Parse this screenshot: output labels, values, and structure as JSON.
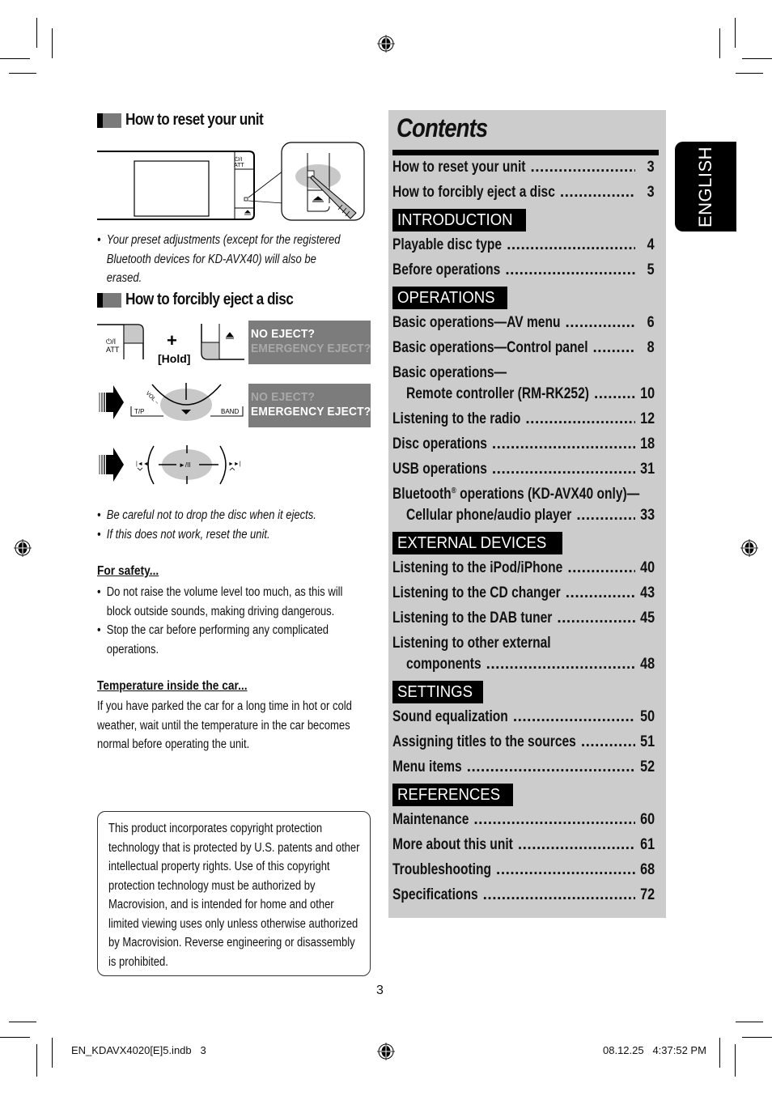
{
  "reset": {
    "title": "How to reset your unit",
    "bullets": [
      "Your preset adjustments (except for the registered Bluetooth devices for KD-AVX40) will also be erased."
    ],
    "illustration_labels": {
      "power": "⏻/I",
      "att": "ATT"
    }
  },
  "eject": {
    "title": "How to forcibly eject a disc",
    "plus": "+",
    "hold": "[Hold]",
    "power_label": "⏻/I",
    "att_label": "ATT",
    "lcd1": {
      "line1": "NO EJECT?",
      "line2": "EMERGENCY EJECT?"
    },
    "lcd2": {
      "line1": "NO EJECT?",
      "line2": "EMERGENCY EJECT?"
    },
    "dial_labels": {
      "vol": "VOL –",
      "tp": "T/P",
      "band": "BAND",
      "play_pause": "►/II"
    },
    "bullets": [
      "Be careful not to drop the disc when it ejects.",
      "If this does not work, reset the unit."
    ]
  },
  "safety": {
    "title": "For safety...",
    "bullets": [
      "Do not raise the volume level too much, as this will block outside sounds, making driving dangerous.",
      "Stop the car before performing any complicated operations."
    ]
  },
  "temperature": {
    "title": "Temperature inside the car...",
    "text": "If you have parked the car for a long time in hot or cold weather, wait until the temperature in the car becomes normal before operating the unit."
  },
  "notice": {
    "text": "This product incorporates copyright protection technology that is protected by U.S. patents and other intellectual property rights. Use of this copyright protection technology must be authorized by Macrovision, and is intended for home and other limited viewing uses only unless otherwise authorized by Macrovision. Reverse engineering or disassembly is prohibited."
  },
  "contents": {
    "title": "Contents",
    "top_entries": [
      {
        "label": "How to reset your unit",
        "page": "3"
      },
      {
        "label": "How to forcibly eject a disc",
        "page": "3"
      }
    ],
    "sections": [
      {
        "heading": "INTRODUCTION",
        "entries": [
          {
            "label": "Playable disc type",
            "page": "4"
          },
          {
            "label": "Before operations",
            "page": "5"
          }
        ]
      },
      {
        "heading": "OPERATIONS",
        "entries": [
          {
            "label": "Basic operations—AV menu",
            "page": "6"
          },
          {
            "label": "Basic operations—Control panel",
            "page": "8"
          },
          {
            "label": "Basic operations—",
            "label2": "Remote controller (RM-RK252)",
            "page": "10"
          },
          {
            "label": "Listening to the radio",
            "page": "12"
          },
          {
            "label": "Disc operations",
            "page": "18"
          },
          {
            "label": "USB operations",
            "page": "31"
          },
          {
            "label": "Bluetooth",
            "label_sup": "®",
            "label_rest": " operations (KD-AVX40 only)—",
            "label2": "Cellular phone/audio player",
            "page": "33"
          }
        ]
      },
      {
        "heading": "EXTERNAL DEVICES",
        "entries": [
          {
            "label": "Listening to the iPod/iPhone",
            "page": "40"
          },
          {
            "label": "Listening to the CD changer",
            "page": "43"
          },
          {
            "label": "Listening to the DAB tuner",
            "page": "45"
          },
          {
            "label": "Listening to other external",
            "label2": "components",
            "page": "48"
          }
        ]
      },
      {
        "heading": "SETTINGS",
        "entries": [
          {
            "label": "Sound equalization",
            "page": "50"
          },
          {
            "label": "Assigning titles to the sources",
            "page": "51"
          },
          {
            "label": "Menu items",
            "page": "52"
          }
        ]
      },
      {
        "heading": "REFERENCES",
        "entries": [
          {
            "label": "Maintenance",
            "page": "60"
          },
          {
            "label": "More about this unit",
            "page": "61"
          },
          {
            "label": "Troubleshooting",
            "page": "68"
          },
          {
            "label": "Specifications",
            "page": "72"
          }
        ]
      }
    ]
  },
  "language_tab": "ENGLISH",
  "page_number": "3",
  "footer": {
    "file": "EN_KDAVX4020[E]5.indb   3",
    "timestamp": "08.12.25   4:37:52 PM"
  }
}
